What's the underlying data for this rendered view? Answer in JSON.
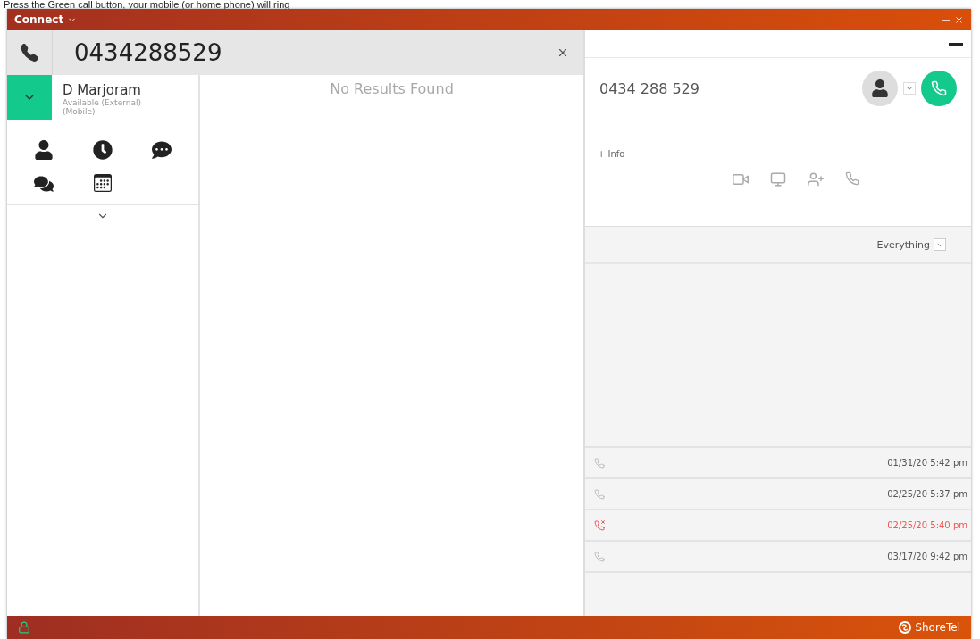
{
  "caption": "Press the Green call button, your mobile (or home phone) will ring",
  "window": {
    "title": "Connect"
  },
  "dialer": {
    "value": "0434288529"
  },
  "user": {
    "name": "D Marjoram",
    "status": "Available (External)",
    "device": "(Mobile)"
  },
  "results": {
    "empty_text": "No Results Found"
  },
  "contact": {
    "number": "0434 288 529",
    "info_link": "+ Info"
  },
  "history": {
    "filter": "Everything",
    "calls": [
      {
        "time": "01/31/20 5:42 pm",
        "missed": false
      },
      {
        "time": "02/25/20 5:37 pm",
        "missed": false
      },
      {
        "time": "02/25/20 5:40 pm",
        "missed": true
      },
      {
        "time": "03/17/20 9:42 pm",
        "missed": false
      }
    ]
  },
  "footer": {
    "brand": "ShoreTel"
  }
}
